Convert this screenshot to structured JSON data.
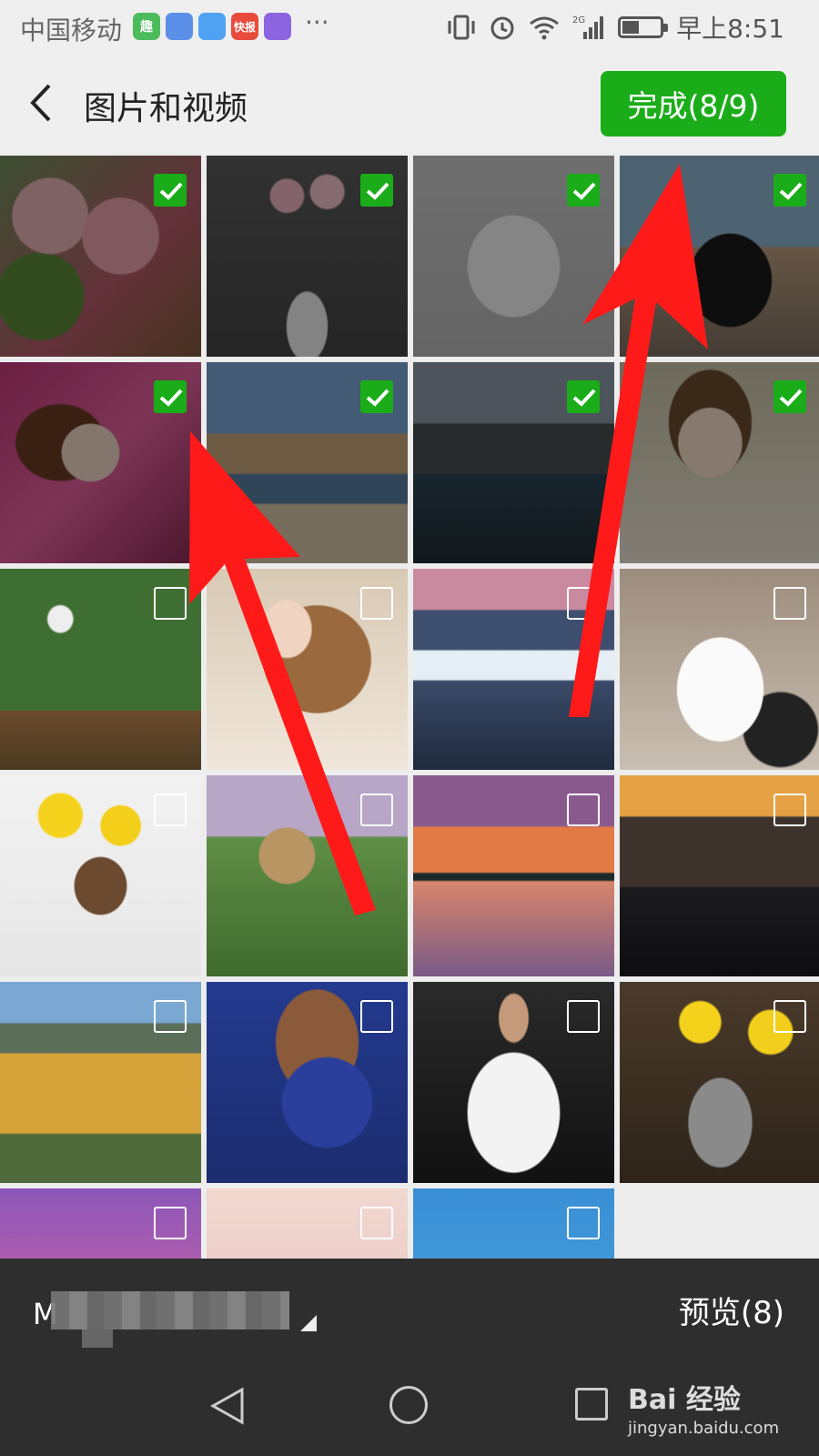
{
  "status_bar": {
    "carrier": "中国移动",
    "app_icons": [
      {
        "name": "app1",
        "color": "#4cbb5b",
        "label": "趣"
      },
      {
        "name": "app2",
        "color": "#5b8fe8",
        "label": ""
      },
      {
        "name": "app3",
        "color": "#4fa2f2",
        "label": ""
      },
      {
        "name": "app4",
        "color": "#e84a3c",
        "label": "快报"
      },
      {
        "name": "app5",
        "color": "#8c64e0",
        "label": ""
      }
    ],
    "more": "···",
    "time": "早上8:51",
    "network": "2G"
  },
  "header": {
    "title": "图片和视频",
    "done_button": "完成(8/9)"
  },
  "grid": {
    "tiles": [
      {
        "selected": true
      },
      {
        "selected": true
      },
      {
        "selected": true
      },
      {
        "selected": true
      },
      {
        "selected": true
      },
      {
        "selected": true
      },
      {
        "selected": true
      },
      {
        "selected": true
      },
      {
        "selected": false
      },
      {
        "selected": false
      },
      {
        "selected": false
      },
      {
        "selected": false
      },
      {
        "selected": false
      },
      {
        "selected": false
      },
      {
        "selected": false
      },
      {
        "selected": false
      },
      {
        "selected": false
      },
      {
        "selected": false
      },
      {
        "selected": false
      },
      {
        "selected": false
      },
      {
        "selected": false
      },
      {
        "selected": false
      },
      {
        "selected": false
      }
    ]
  },
  "bottom_bar": {
    "album_initial": "M",
    "preview_button": "预览(8)"
  },
  "watermark": {
    "brand": "Bai 经验",
    "url": "jingyan.baidu.com"
  },
  "colors": {
    "accent_green": "#1aad19",
    "annotation_red": "#ff1a1a"
  }
}
